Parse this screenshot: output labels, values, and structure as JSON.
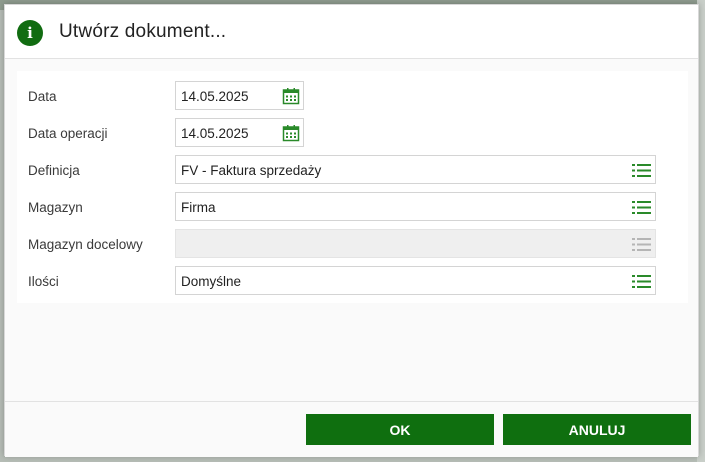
{
  "dialog": {
    "title": "Utwórz dokument...",
    "info_icon_glyph": "i"
  },
  "form": {
    "fields": [
      {
        "label": "Data",
        "value": "14.05.2025",
        "icon": "calendar-icon"
      },
      {
        "label": "Data operacji",
        "value": "14.05.2025",
        "icon": "calendar-icon"
      },
      {
        "label": "Definicja",
        "value": "FV - Faktura sprzedaży",
        "icon": "list-icon"
      },
      {
        "label": "Magazyn",
        "value": "Firma",
        "icon": "list-icon"
      },
      {
        "label": "Magazyn docelowy",
        "value": "",
        "icon": "list-icon",
        "disabled": true
      },
      {
        "label": "Ilości",
        "value": "Domyślne",
        "icon": "list-icon"
      }
    ]
  },
  "buttons": {
    "ok": "OK",
    "cancel": "ANULUJ"
  },
  "colors": {
    "accent": "#0f6f0f",
    "icon_green": "#2a8a2a",
    "icon_disabled": "#b5b5b5"
  }
}
